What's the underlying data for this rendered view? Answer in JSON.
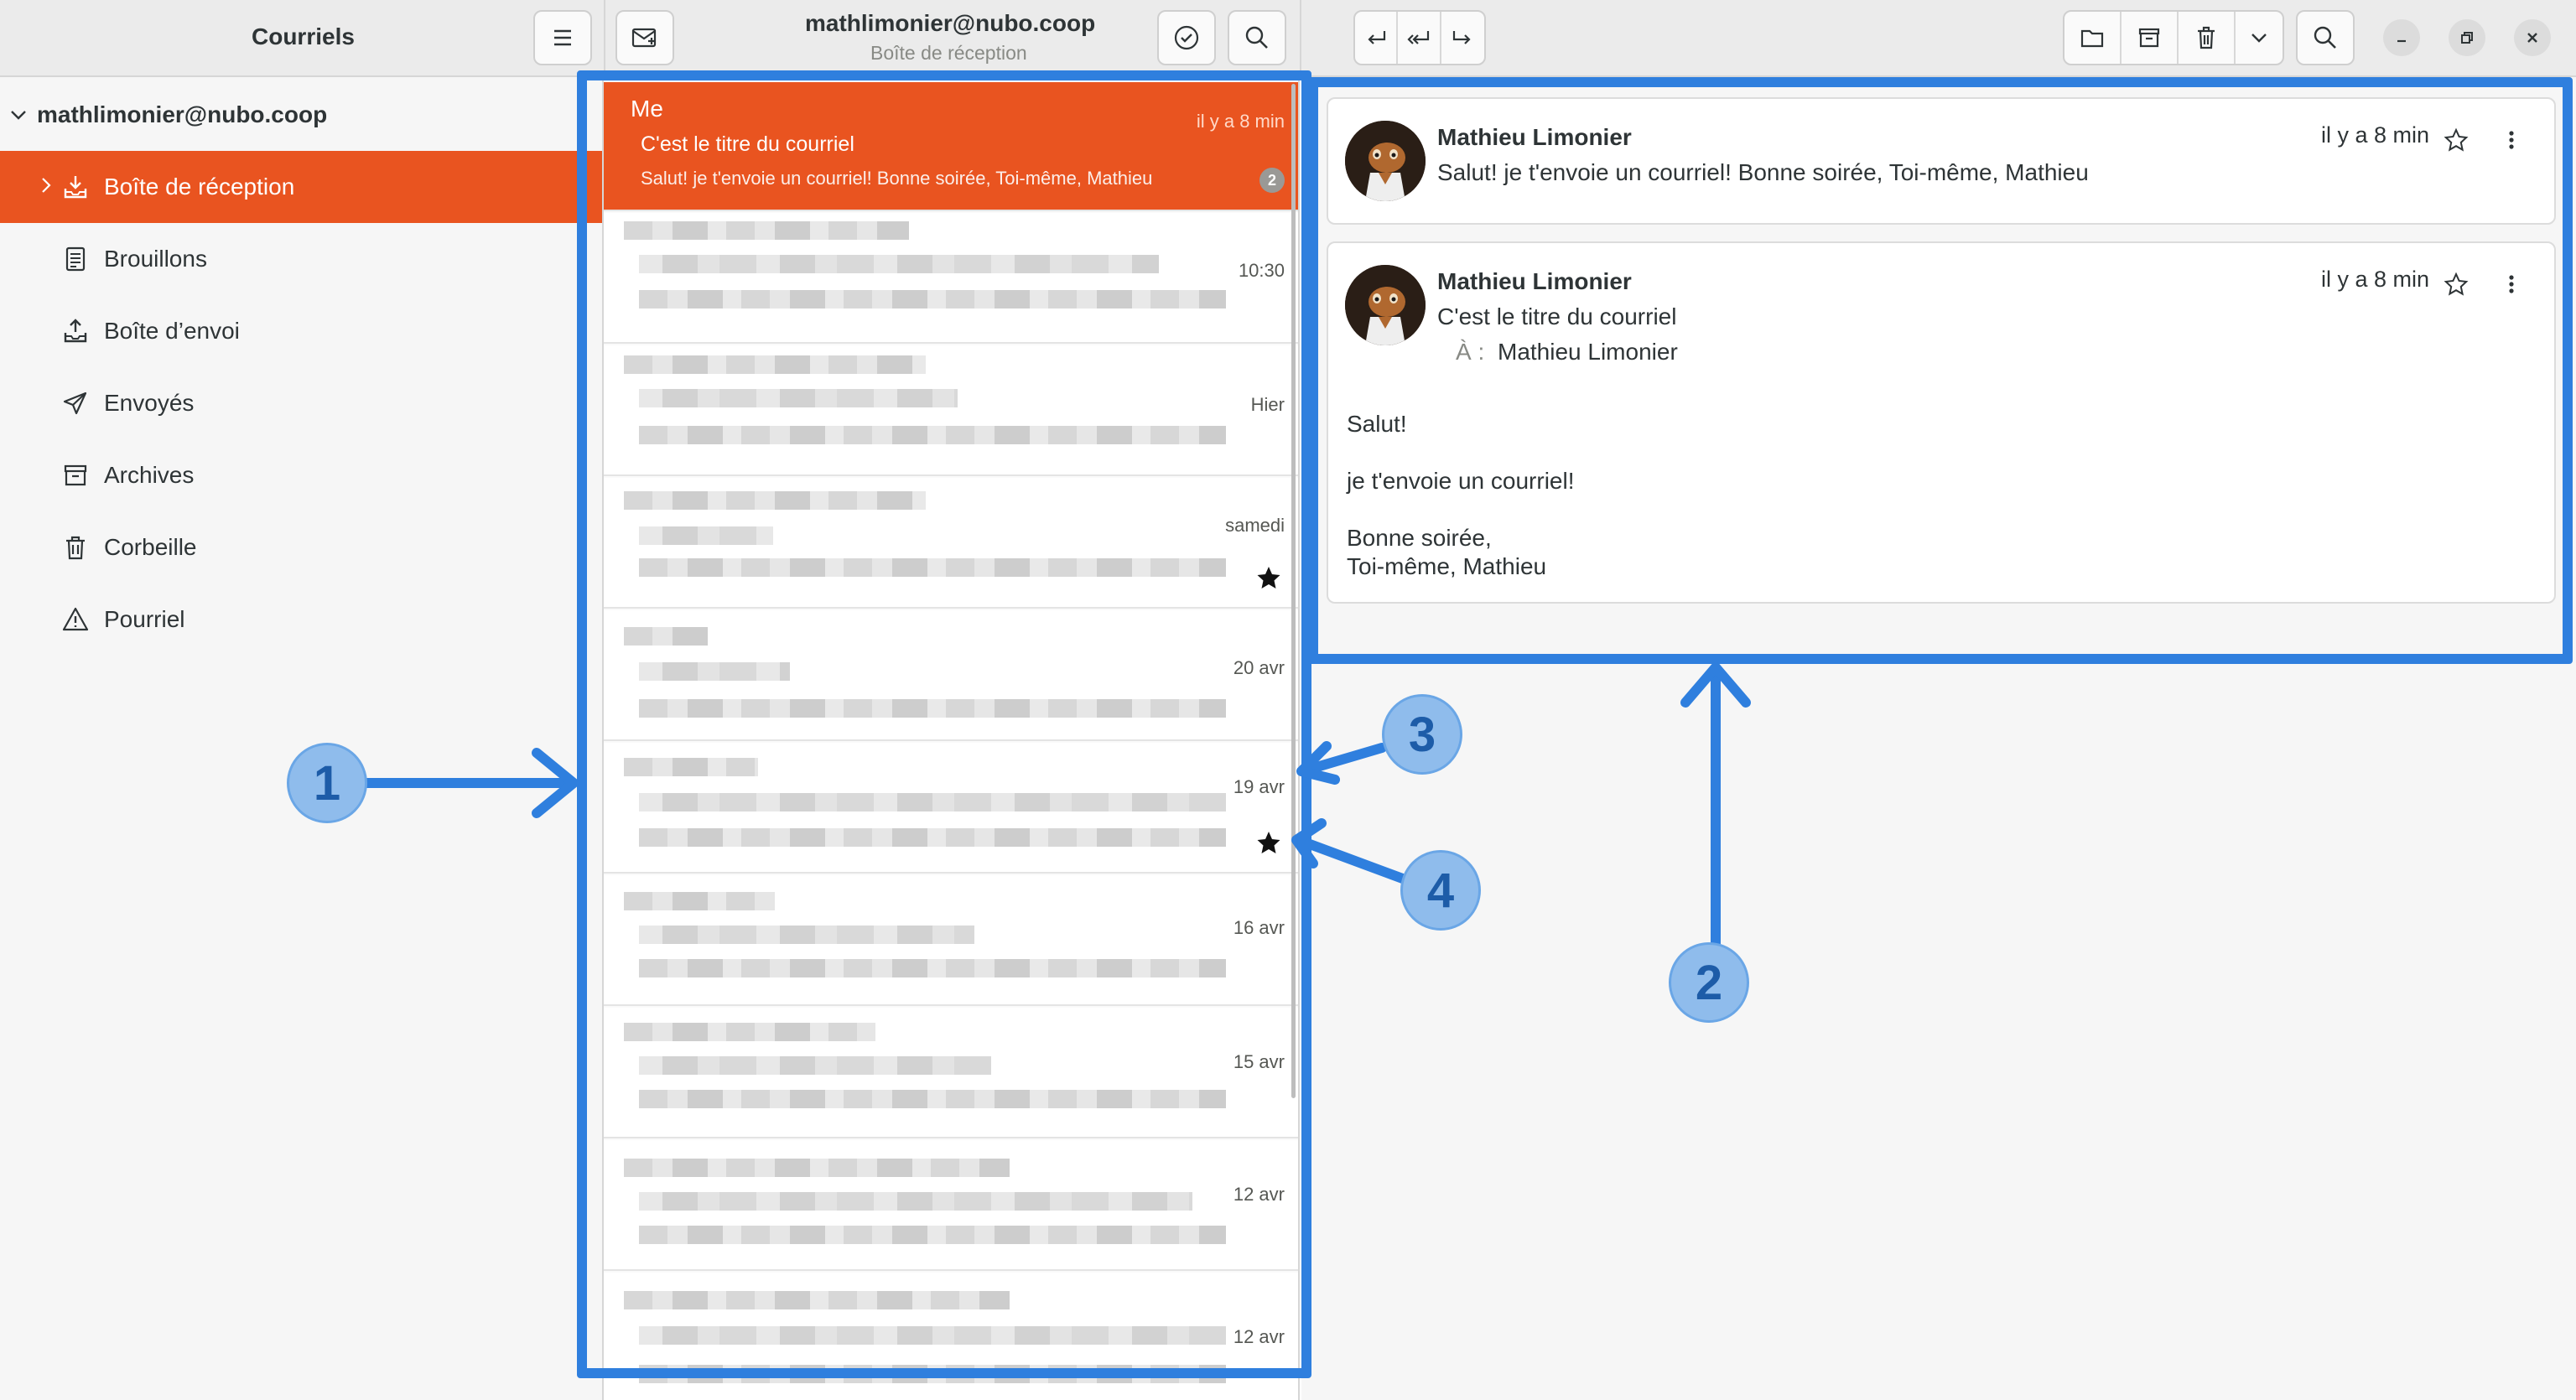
{
  "header": {
    "sidebar_title": "Courriels",
    "account_title": "mathlimonier@nubo.coop",
    "folder_subtitle": "Boîte de réception"
  },
  "sidebar": {
    "account": "mathlimonier@nubo.coop",
    "items": [
      {
        "label": "Boîte de réception",
        "icon": "inbox-icon",
        "active": true
      },
      {
        "label": "Brouillons",
        "icon": "drafts-icon"
      },
      {
        "label": "Boîte d’envoi",
        "icon": "outbox-icon"
      },
      {
        "label": "Envoyés",
        "icon": "sent-icon"
      },
      {
        "label": "Archives",
        "icon": "archive-icon"
      },
      {
        "label": "Corbeille",
        "icon": "trash-icon"
      },
      {
        "label": "Pourriel",
        "icon": "spam-icon"
      }
    ]
  },
  "message_list": {
    "selected": {
      "from": "Me",
      "subject": "C'est le titre du courriel",
      "preview": "Salut! je t'envoie un courriel! Bonne soirée, Toi-même, Mathieu",
      "time": "il y a 8 min",
      "count": "2"
    },
    "others": [
      {
        "time": "10:30",
        "starred": false
      },
      {
        "time": "Hier",
        "starred": false
      },
      {
        "time": "samedi",
        "starred": true
      },
      {
        "time": "20 avr",
        "starred": false
      },
      {
        "time": "19 avr",
        "starred": true
      },
      {
        "time": "16 avr",
        "starred": false
      },
      {
        "time": "15 avr",
        "starred": false
      },
      {
        "time": "12 avr",
        "starred": false
      },
      {
        "time": "12 avr",
        "starred": false
      }
    ]
  },
  "reader": {
    "collapsed": {
      "sender": "Mathieu Limonier",
      "preview": "Salut! je t'envoie un courriel! Bonne soirée, Toi-même, Mathieu",
      "time": "il y a 8 min"
    },
    "expanded": {
      "sender": "Mathieu Limonier",
      "subject": "C'est le titre du courriel",
      "to_label": "À :",
      "to": "Mathieu Limonier",
      "time": "il y a 8 min",
      "body": [
        "Salut!",
        "je t'envoie un courriel!",
        "Bonne soirée,",
        "Toi-même, Mathieu"
      ]
    }
  },
  "annotations": [
    "1",
    "2",
    "3",
    "4"
  ],
  "colors": {
    "accent": "#e95420",
    "highlight": "#2f7fde",
    "callout": "#8fbcec"
  }
}
